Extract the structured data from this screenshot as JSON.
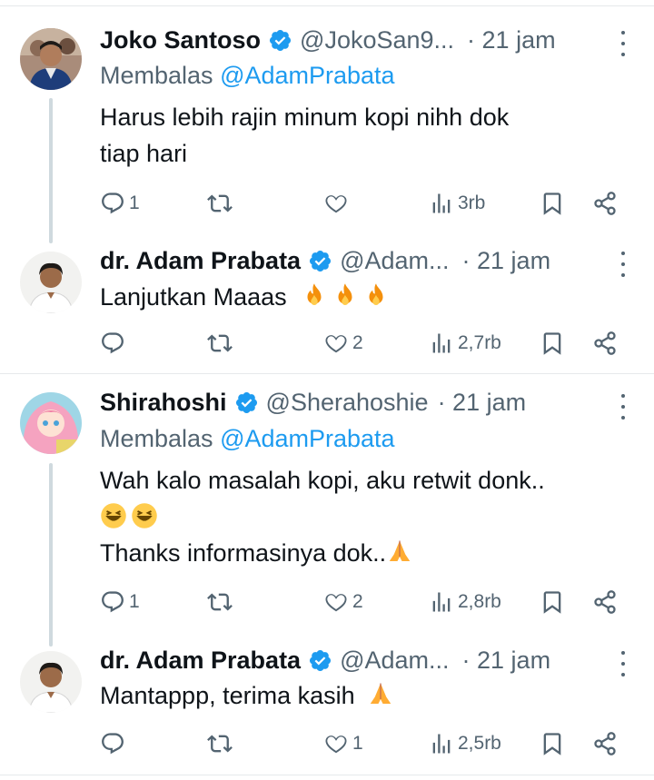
{
  "tweets": [
    {
      "name": "Joko Santoso",
      "handle": "@JokoSan9...",
      "time": "· 21 jam",
      "reply_label": "Membalas",
      "reply_mention": "@AdamPrabata",
      "text_lines": [
        "Harus lebih rajin minum kopi nihh dok",
        "tiap hari"
      ],
      "avatar": "avatar-joko",
      "stats": {
        "replies": "1",
        "retweets": "",
        "likes": "",
        "views": "3rb"
      }
    },
    {
      "name": "dr. Adam Prabata",
      "handle": "@Adam...",
      "time": "· 21 jam",
      "text_lines": [
        "Lanjutkan Maaas"
      ],
      "emojis_line1": [
        "fire-emoji",
        "fire-emoji",
        "fire-emoji"
      ],
      "avatar": "avatar-adam",
      "stats": {
        "replies": "",
        "retweets": "",
        "likes": "2",
        "views": "2,7rb"
      }
    },
    {
      "name": "Shirahoshi",
      "handle": "@Sherahoshie",
      "time": "· 21 jam",
      "reply_label": "Membalas",
      "reply_mention": "@AdamPrabata",
      "text_lines": [
        "Wah kalo masalah kopi, aku retwit donk..",
        "",
        "Thanks informasinya dok.."
      ],
      "avatar": "avatar-shirahoshi",
      "stats": {
        "replies": "1",
        "retweets": "",
        "likes": "2",
        "views": "2,8rb"
      }
    },
    {
      "name": "dr. Adam Prabata",
      "handle": "@Adam...",
      "time": "· 21 jam",
      "text_lines": [
        "Mantappp, terima kasih"
      ],
      "avatar": "avatar-adam",
      "stats": {
        "replies": "",
        "retweets": "",
        "likes": "1",
        "views": "2,5rb"
      }
    }
  ],
  "colors": {
    "text": "#0f1419",
    "muted": "#536471",
    "link": "#1d9bf0",
    "verified": "#1d9bf0",
    "line": "#cfd9de"
  }
}
